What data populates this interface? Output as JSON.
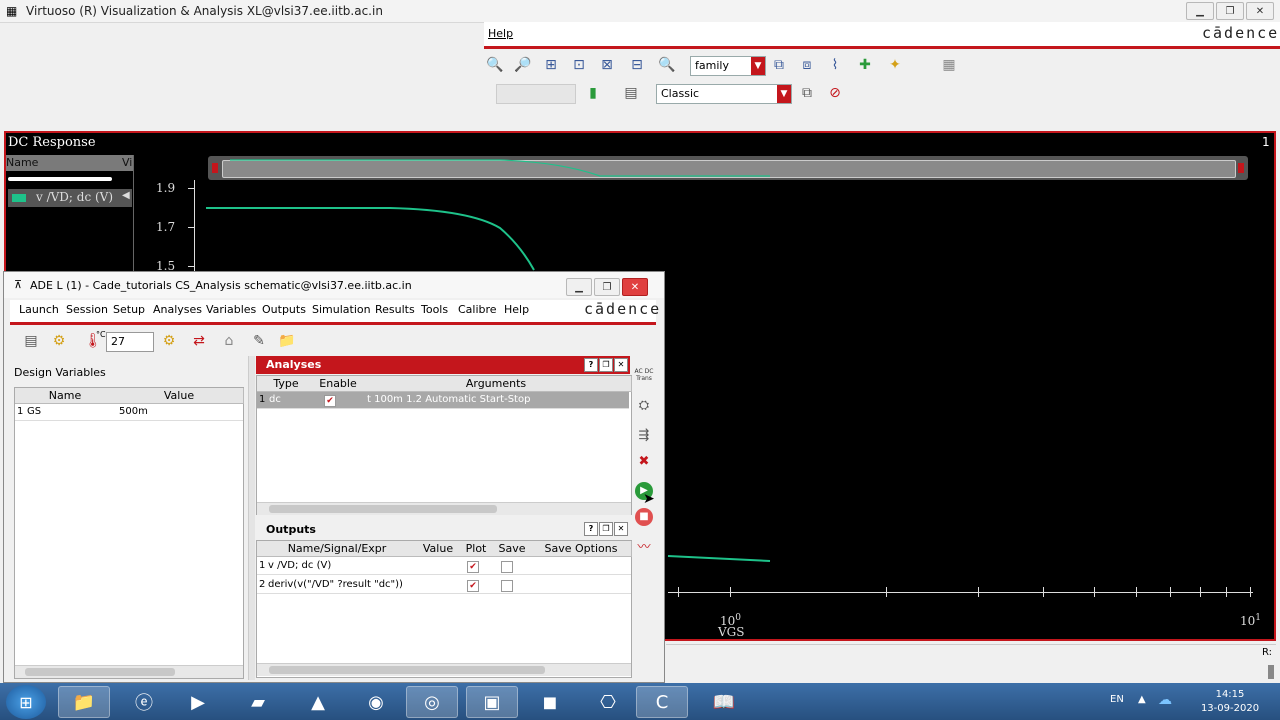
{
  "viz_window": {
    "title": "Virtuoso (R) Visualization & Analysis XL@vlsi37.ee.iitb.ac.in",
    "menu_help": "Help",
    "brand": "cādence",
    "family_combo": "family",
    "style_combo": "Classic"
  },
  "plot": {
    "title": "DC Response",
    "subwindow_number": "1",
    "legend_header_name": "Name",
    "legend_header_vis": "Vis",
    "legend_entry": "v /VD; dc (V)",
    "status_right": "R:"
  },
  "chart_data": {
    "type": "line",
    "title": "DC Response",
    "xlabel": "VGS",
    "x_scale": "log",
    "x_tick_labels": [
      "10^0",
      "10^1"
    ],
    "y_tick_labels": [
      "1.9",
      "1.7",
      "1.5"
    ],
    "series": [
      {
        "name": "v /VD; dc (V)",
        "color": "#1ec28a"
      }
    ]
  },
  "ade": {
    "title": "ADE L (1) - Cade_tutorials CS_Analysis schematic@vlsi37.ee.iitb.ac.in",
    "brand": "cādence",
    "menu": [
      {
        "label": "Launch"
      },
      {
        "label": "Session"
      },
      {
        "label": "Setup"
      },
      {
        "label": "Analyses"
      },
      {
        "label": "Variables"
      },
      {
        "label": "Outputs"
      },
      {
        "label": "Simulation"
      },
      {
        "label": "Results"
      },
      {
        "label": "Tools"
      },
      {
        "label": "Calibre"
      },
      {
        "label": "Help"
      }
    ],
    "temperature_unit": "°C",
    "temperature": "27",
    "design_variables": {
      "label": "Design Variables",
      "col_name": "Name",
      "col_value": "Value",
      "rows": [
        {
          "idx": "1",
          "name": "GS",
          "value": "500m"
        }
      ]
    },
    "analyses": {
      "title": "Analyses",
      "col_type": "Type",
      "col_enable": "Enable",
      "col_args": "Arguments",
      "rows": [
        {
          "idx": "1",
          "type": "dc",
          "enabled": "✔",
          "args": "t 100m 1.2 Automatic Start-Stop"
        }
      ]
    },
    "outputs": {
      "title": "Outputs",
      "col_name": "Name/Signal/Expr",
      "col_value": "Value",
      "col_plot": "Plot",
      "col_save": "Save",
      "col_save_options": "Save Options",
      "rows": [
        {
          "idx": "1",
          "name": "v /VD; dc (V)",
          "plot": "✔"
        },
        {
          "idx": "2",
          "name": "deriv(v(\"/VD\" ?result \"dc\"))",
          "plot": "✔"
        }
      ]
    },
    "side_label_ac": "AC DC Trans"
  },
  "taskbar": {
    "lang": "EN",
    "time": "14:15",
    "date": "13-09-2020"
  },
  "colors": {
    "cadence_red": "#c4161c",
    "trace_green": "#1ec28a"
  }
}
